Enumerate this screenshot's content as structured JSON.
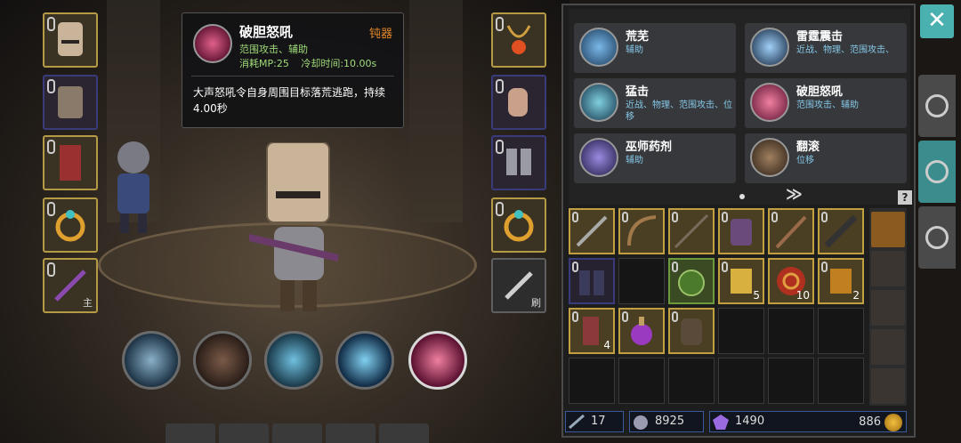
{
  "tooltip": {
    "skill_name": "破胆怒吼",
    "weapon_type": "钝器",
    "tags": "范围攻击、辅助",
    "mp_cost": "消耗MP:25",
    "cooldown": "冷却时间:10.00s",
    "description": "大声怒吼令自身周围目标落荒逃跑，持续4.00秒"
  },
  "equipment": {
    "main_hand_tag": "主",
    "brush_tag": "刷"
  },
  "skills": [
    {
      "name": "荒芜",
      "tags": "辅助",
      "color": "#3c7fc0"
    },
    {
      "name": "雷霆震击",
      "tags": "近战、物理、范围攻击、",
      "color": "#5aa0e0"
    },
    {
      "name": "猛击",
      "tags": "近战、物理、范围攻击、位移",
      "color": "#3a9ab0"
    },
    {
      "name": "破胆怒吼",
      "tags": "范围攻击、辅助",
      "color": "#c04070"
    },
    {
      "name": "巫师药剂",
      "tags": "辅助",
      "color": "#6a5ab0"
    },
    {
      "name": "翻滚",
      "tags": "位移",
      "color": "#8a6a4a"
    }
  ],
  "inventory": {
    "counts": {
      "scroll": "5",
      "swirl": "10",
      "book": "2",
      "boots": "4"
    }
  },
  "stats": {
    "attack": "17",
    "power": "8925",
    "gems": "1490",
    "gold": "886"
  },
  "ui": {
    "close_icon": "✕",
    "next_arrows": "≫",
    "help": "?"
  }
}
